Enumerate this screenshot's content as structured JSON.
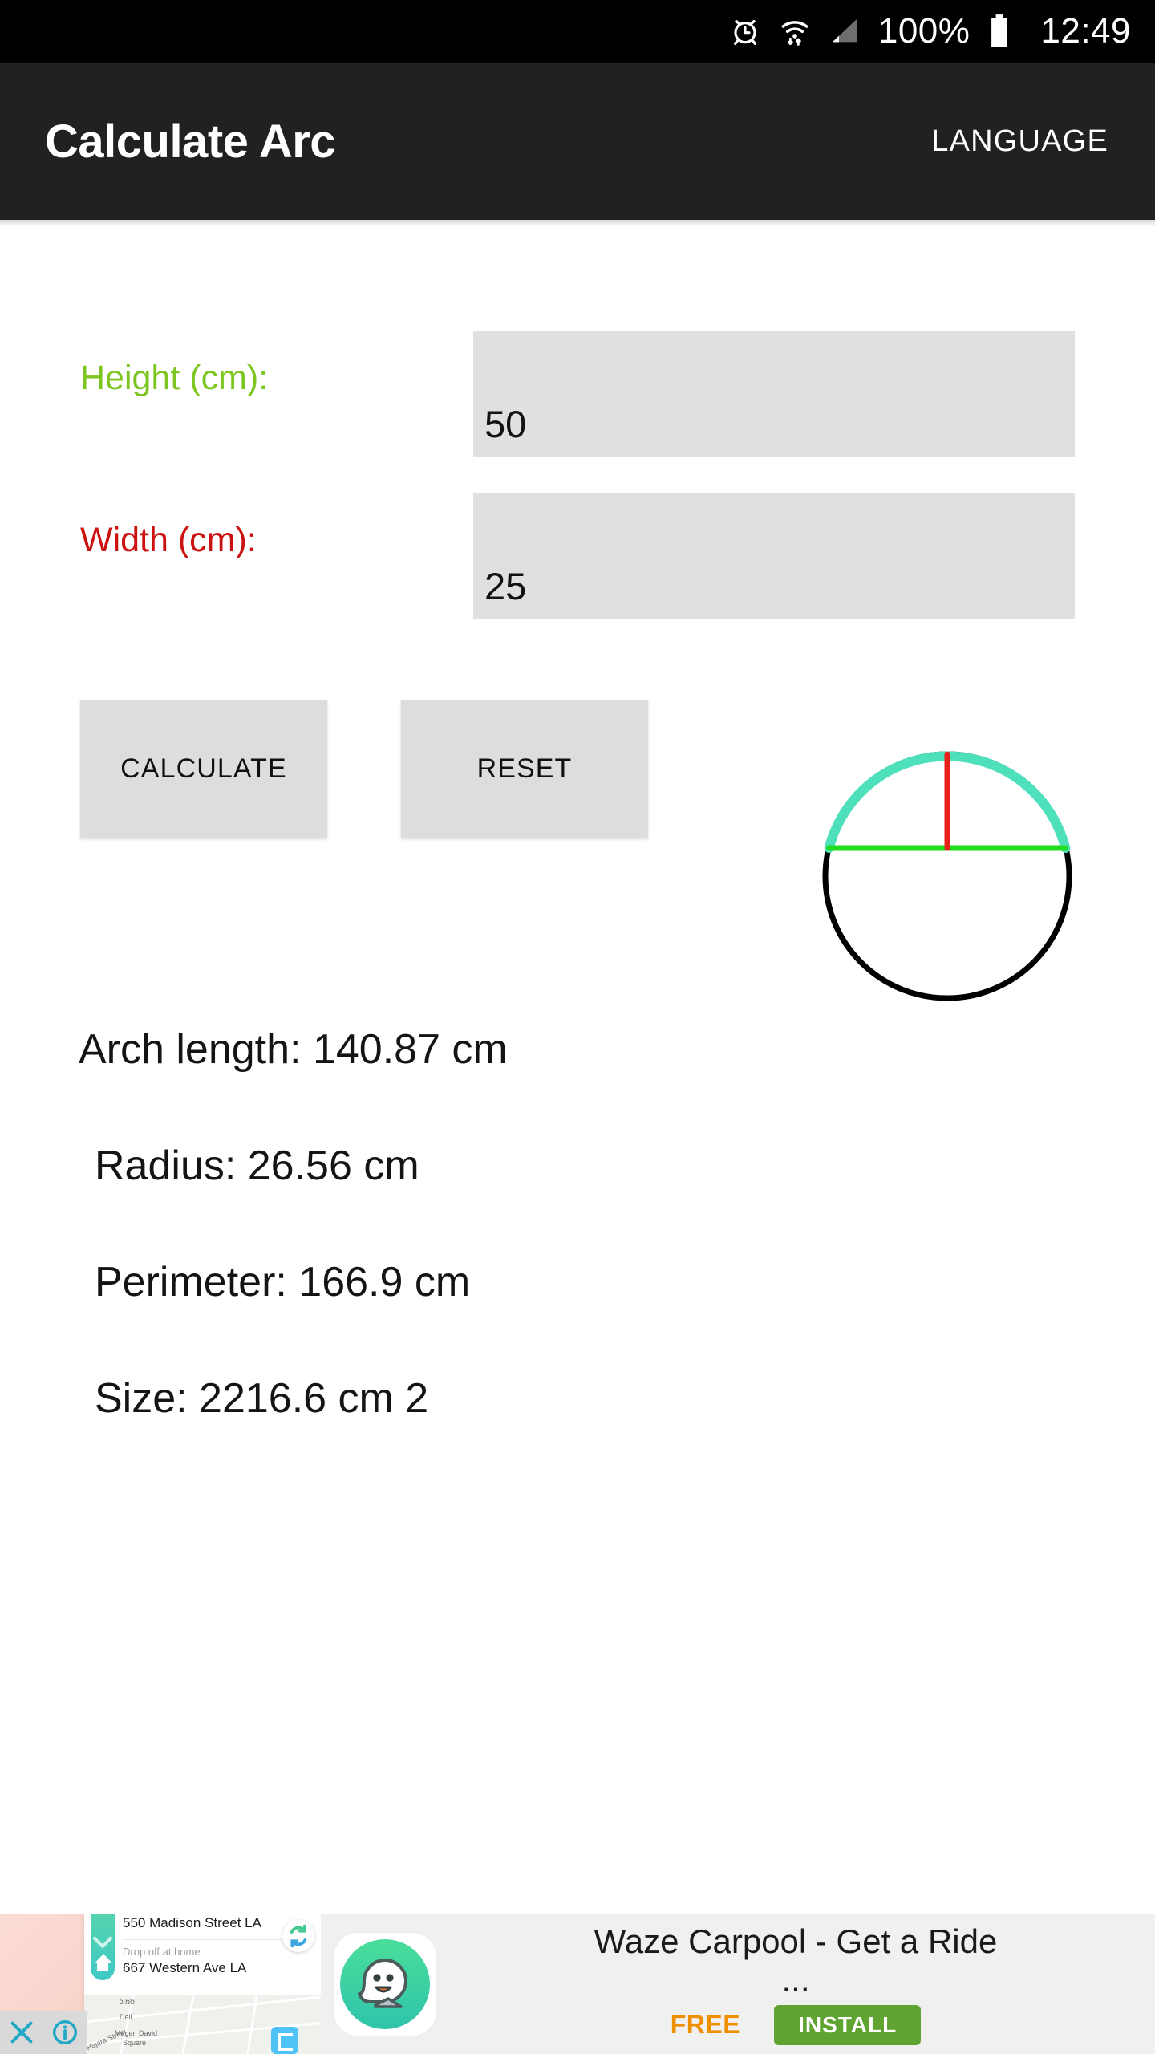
{
  "status_bar": {
    "icons": [
      "alarm-clock-icon",
      "wifi-icon",
      "cellular-signal-icon",
      "battery-icon"
    ],
    "battery_percent": "100%",
    "time": "12:49",
    "background": "#000000"
  },
  "app_bar": {
    "title": "Calculate Arc",
    "action_label": "LANGUAGE",
    "background": "#212121"
  },
  "form": {
    "height_field": {
      "label": "Height (cm):",
      "label_color": "#7dc520",
      "value": "50",
      "placeholder": ""
    },
    "width_field": {
      "label": "Width (cm):",
      "label_color": "#cc1111",
      "value": "25",
      "placeholder": ""
    }
  },
  "buttons": {
    "calculate_label": "CALCULATE",
    "reset_label": "RESET"
  },
  "diagram": {
    "name": "arc-diagram",
    "circle_color": "#000000",
    "arc_color": "#4ee0bb",
    "chord_color": "#22dd22",
    "height_line_color": "#e8201a"
  },
  "results": [
    {
      "label": "Arch length:",
      "value": "140.87",
      "unit": "cm",
      "text": "Arch length: 140.87 cm"
    },
    {
      "label": "Radius:",
      "value": "26.56",
      "unit": "cm",
      "text": "Radius: 26.56 cm"
    },
    {
      "label": "Perimeter:",
      "value": "166.9",
      "unit": "cm",
      "text": "Perimeter: 166.9 cm"
    },
    {
      "label": "Size:",
      "value": "2216.6",
      "unit": "cm 2",
      "text": "Size: 2216.6 cm 2"
    }
  ],
  "ad": {
    "title": "Waze Carpool - Get a Ride ...",
    "price_label": "FREE",
    "install_label": "INSTALL",
    "install_color": "#5fa331",
    "price_color": "#ef9000",
    "close_icon": "close-icon",
    "info_icon": "info-icon",
    "creative": {
      "address_primary": "550 Madison Street LA",
      "dropoff_caption": "Drop off at home",
      "address_secondary": "667 Western Ave LA",
      "map_labels": [
        "סמיכ",
        "Deli",
        "Magen David",
        "Square",
        "Hajara Street"
      ]
    }
  }
}
